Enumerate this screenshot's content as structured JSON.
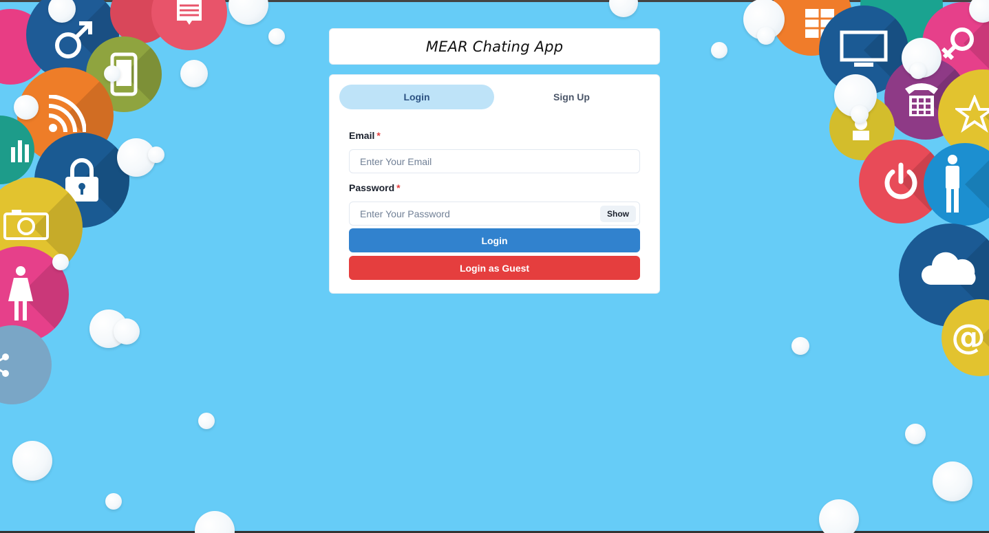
{
  "header": {
    "title": "MEAR Chating App"
  },
  "tabs": [
    {
      "label": "Login",
      "active": true
    },
    {
      "label": "Sign Up",
      "active": false
    }
  ],
  "form": {
    "email_label": "Email",
    "email_placeholder": "Enter Your Email",
    "password_label": "Password",
    "password_placeholder": "Enter Your Password",
    "required_mark": "*",
    "show_label": "Show",
    "login_label": "Login",
    "guest_label": "Login as Guest"
  },
  "colors": {
    "background": "#66ccf7",
    "tab_active": "#bee3f8",
    "primary": "#3182ce",
    "danger": "#e53e3e",
    "required": "#e53e3e"
  },
  "background_icons": [
    "male-icon",
    "mobile-icon",
    "wifi-icon",
    "lock-icon",
    "bar-chart-icon",
    "camera-icon",
    "female-icon",
    "share-icon",
    "document-icon",
    "monitor-icon",
    "telephone-icon",
    "star-icon",
    "person-icon",
    "power-icon",
    "cloud-icon",
    "at-sign-icon",
    "female-symbol-icon"
  ]
}
